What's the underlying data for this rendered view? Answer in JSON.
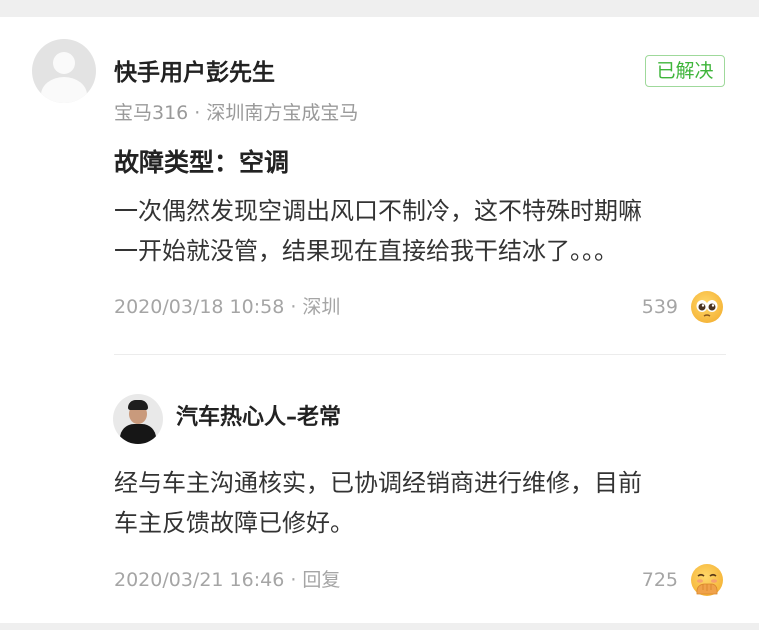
{
  "question": {
    "username": "快手用户彭先生",
    "car_info": "宝马316 · 深圳南方宝成宝马",
    "status_badge": "已解决",
    "fault_type": "故障类型：空调",
    "text_lines": [
      "一次偶然发现空调出风口不制冷，这不特殊时期嘛",
      "一开始就没管，结果现在直接给我干结冰了。。。"
    ],
    "meta": "2020/03/18 10:58 · 深圳",
    "like_count": "539",
    "emoji_icon": "pleading-face-icon"
  },
  "reply": {
    "username": "汽车热心人–老常",
    "text_lines": [
      "经与车主沟通核实，已协调经销商进行维修，目前",
      "车主反馈故障已修好。"
    ],
    "meta": "2020/03/21 16:46 · 回复",
    "like_count": "725",
    "emoji_icon": "face-with-hand-over-mouth-icon"
  },
  "colors": {
    "resolved_green": "#3fb53b",
    "meta_gray": "#a5a5a5",
    "emoji_yellow": "#f6b73c"
  }
}
